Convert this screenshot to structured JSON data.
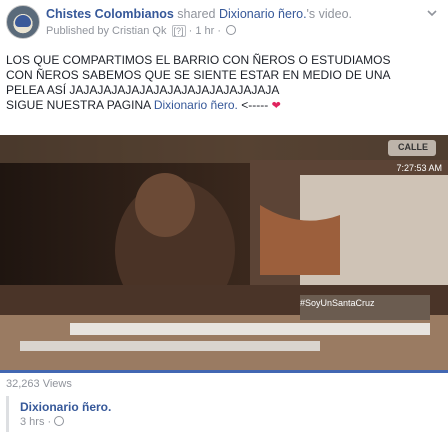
{
  "post": {
    "page_name": "Chistes Colombianos",
    "shared_word": "shared",
    "source_page": "Dixionario ñero.",
    "source_suffix": "'s video.",
    "published_by": "Published by Cristian Qk",
    "help_mark": "[?]",
    "time_sep": "·",
    "time": "1 hr",
    "text_line1": "LOS QUE COMPARTIMOS EL BARRIO CON ÑEROS O ESTUDIAMOS",
    "text_line2": "CON ÑEROS SABEMOS QUE SE SIENTE ESTAR EN MEDIO DE UNA",
    "text_line3": "PELEA ASÍ JAJAJAJAJAJAJAJAJAJAJAJAJAJAJA",
    "text_line4_prefix": "SIGUE NUESTRA PAGINA",
    "text_line4_tag": "Dixionario ñero.",
    "text_line4_arrow": "<-----"
  },
  "video": {
    "overlay_logo": "CALLE",
    "timestamp": "7:27:53 AM",
    "watermark": "#SoyUnSantaCruz",
    "progress_color": "#4267b2"
  },
  "stats": {
    "views": "32,263 Views"
  },
  "shared": {
    "name": "Dixionario ñero.",
    "time": "3 hrs",
    "sep": "·"
  },
  "colors": {
    "link": "#365899",
    "muted": "#90949c",
    "heart": "#e0245e"
  },
  "icons": {
    "menu": "chevron-down-icon",
    "privacy": "globe-icon",
    "reaction": "heart-icon"
  }
}
